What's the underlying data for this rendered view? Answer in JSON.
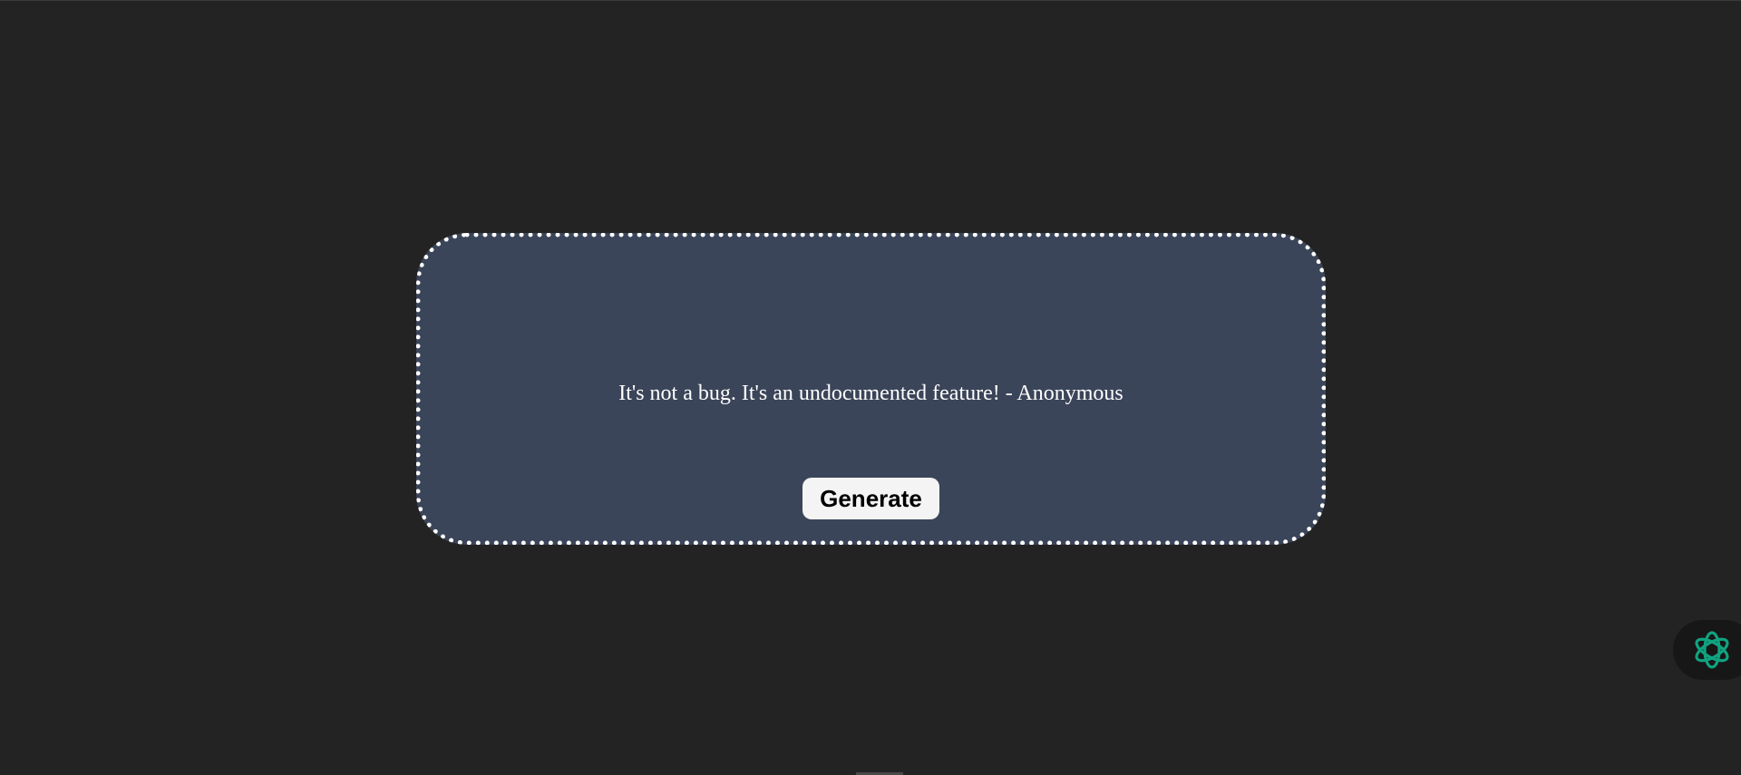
{
  "quote": {
    "text": "It's not a bug. It's an undocumented feature! - Anonymous"
  },
  "actions": {
    "generate_label": "Generate"
  },
  "assistant": {
    "icon": "openai-knot-icon",
    "icon_color": "#10a37f"
  },
  "colors": {
    "page_background": "#232323",
    "card_background": "#3b4559",
    "card_border": "#ffffff",
    "button_background": "#f4f4f4"
  }
}
